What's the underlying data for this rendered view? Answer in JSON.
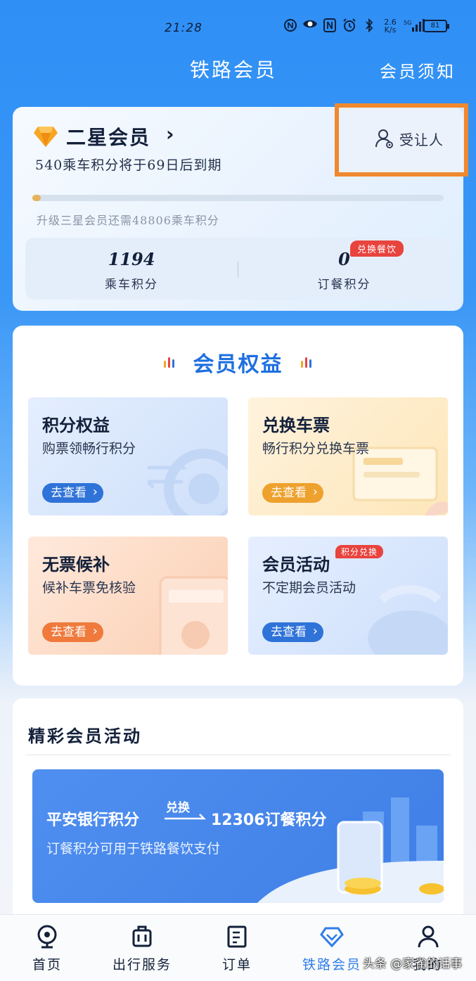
{
  "status_bar": {
    "time": "21:28",
    "net_speed": "2.6\nK/s",
    "signal": "5G",
    "battery": "81"
  },
  "header": {
    "title": "铁路会员",
    "notice": "会员须知"
  },
  "member": {
    "level": "二星会员",
    "chevron": "›",
    "expire_note": "540乘车积分将于69日后到期",
    "transferee": "受让人",
    "progress_fraction": 0.02,
    "upgrade_note": "升级三星会员还需48806乘车积分",
    "ride_points": "1194",
    "ride_points_label": "乘车积分",
    "meal_points": "0",
    "meal_points_label": "订餐积分",
    "meal_badge": "兑换餐饮"
  },
  "benefits": {
    "heading": "会员权益",
    "tiles": [
      {
        "title": "积分权益",
        "subtitle": "购票领畅行积分",
        "button": "去查看",
        "badge": ""
      },
      {
        "title": "兑换车票",
        "subtitle": "畅行积分兑换车票",
        "button": "去查看",
        "badge": ""
      },
      {
        "title": "无票候补",
        "subtitle": "候补车票免核验",
        "button": "去查看",
        "badge": ""
      },
      {
        "title": "会员活动",
        "subtitle": "不定期会员活动",
        "button": "去查看",
        "badge": "积分兑换"
      }
    ]
  },
  "activities": {
    "heading": "精彩会员活动",
    "banner": {
      "title": "平安银行积分",
      "exchange": "兑换",
      "target": "12306订餐积分",
      "subtitle": "订餐积分可用于铁路餐饮支付"
    }
  },
  "nav": {
    "items": [
      {
        "label": "首页",
        "icon": "home-icon"
      },
      {
        "label": "出行服务",
        "icon": "luggage-icon"
      },
      {
        "label": "订单",
        "icon": "order-icon"
      },
      {
        "label": "铁路会员",
        "icon": "diamond-icon"
      },
      {
        "label": "我的",
        "icon": "person-icon"
      }
    ],
    "active_index": 3
  },
  "watermark": "头条 @家雀的话事",
  "colors": {
    "accent": "#2f7de8",
    "highlight_box": "#f0882e",
    "badge_red": "#e9433e"
  }
}
